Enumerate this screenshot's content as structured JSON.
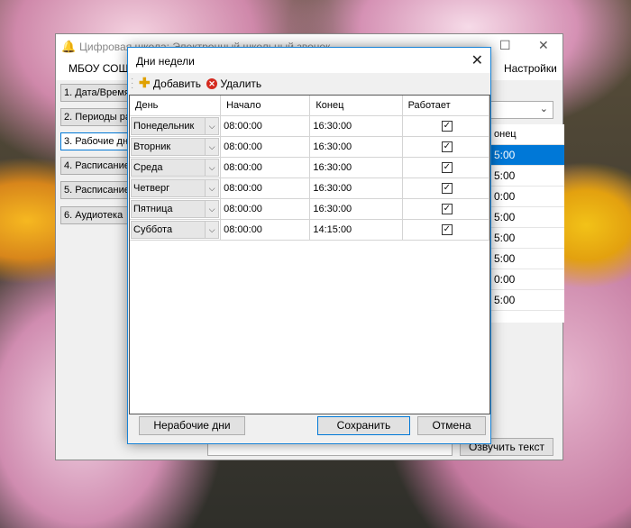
{
  "main_window": {
    "title": "Цифровая школа: Электронный школьный звонок",
    "menu": [
      "МБОУ СОШ",
      "Настройки"
    ],
    "nav_buttons": [
      "1. Дата/Время",
      "2. Периоды ра",
      "3. Рабочие дни",
      "4. Расписание",
      "5. Расписание",
      "6. Аудиотека"
    ],
    "grid_header": "онец",
    "grid_values": [
      "5:00",
      "5:00",
      "0:00",
      "5:00",
      "5:00",
      "5:00",
      "0:00",
      "5:00"
    ],
    "speak_button": "Озвучить текст"
  },
  "dialog": {
    "title": "Дни недели",
    "close_glyph": "✕",
    "toolbar": {
      "add_label": "Добавить",
      "delete_label": "Удалить"
    },
    "columns": [
      "День",
      "Начало",
      "Конец",
      "Работает"
    ],
    "rows": [
      {
        "day": "Понедельник",
        "start": "08:00:00",
        "end": "16:30:00",
        "works": "✓"
      },
      {
        "day": "Вторник",
        "start": "08:00:00",
        "end": "16:30:00",
        "works": "✓"
      },
      {
        "day": "Среда",
        "start": "08:00:00",
        "end": "16:30:00",
        "works": "✓"
      },
      {
        "day": "Четверг",
        "start": "08:00:00",
        "end": "16:30:00",
        "works": "✓"
      },
      {
        "day": "Пятница",
        "start": "08:00:00",
        "end": "16:30:00",
        "works": "✓"
      },
      {
        "day": "Суббота",
        "start": "08:00:00",
        "end": "14:15:00",
        "works": "✓"
      }
    ],
    "buttons": {
      "holidays": "Нерабочие дни",
      "save": "Сохранить",
      "cancel": "Отмена"
    }
  }
}
